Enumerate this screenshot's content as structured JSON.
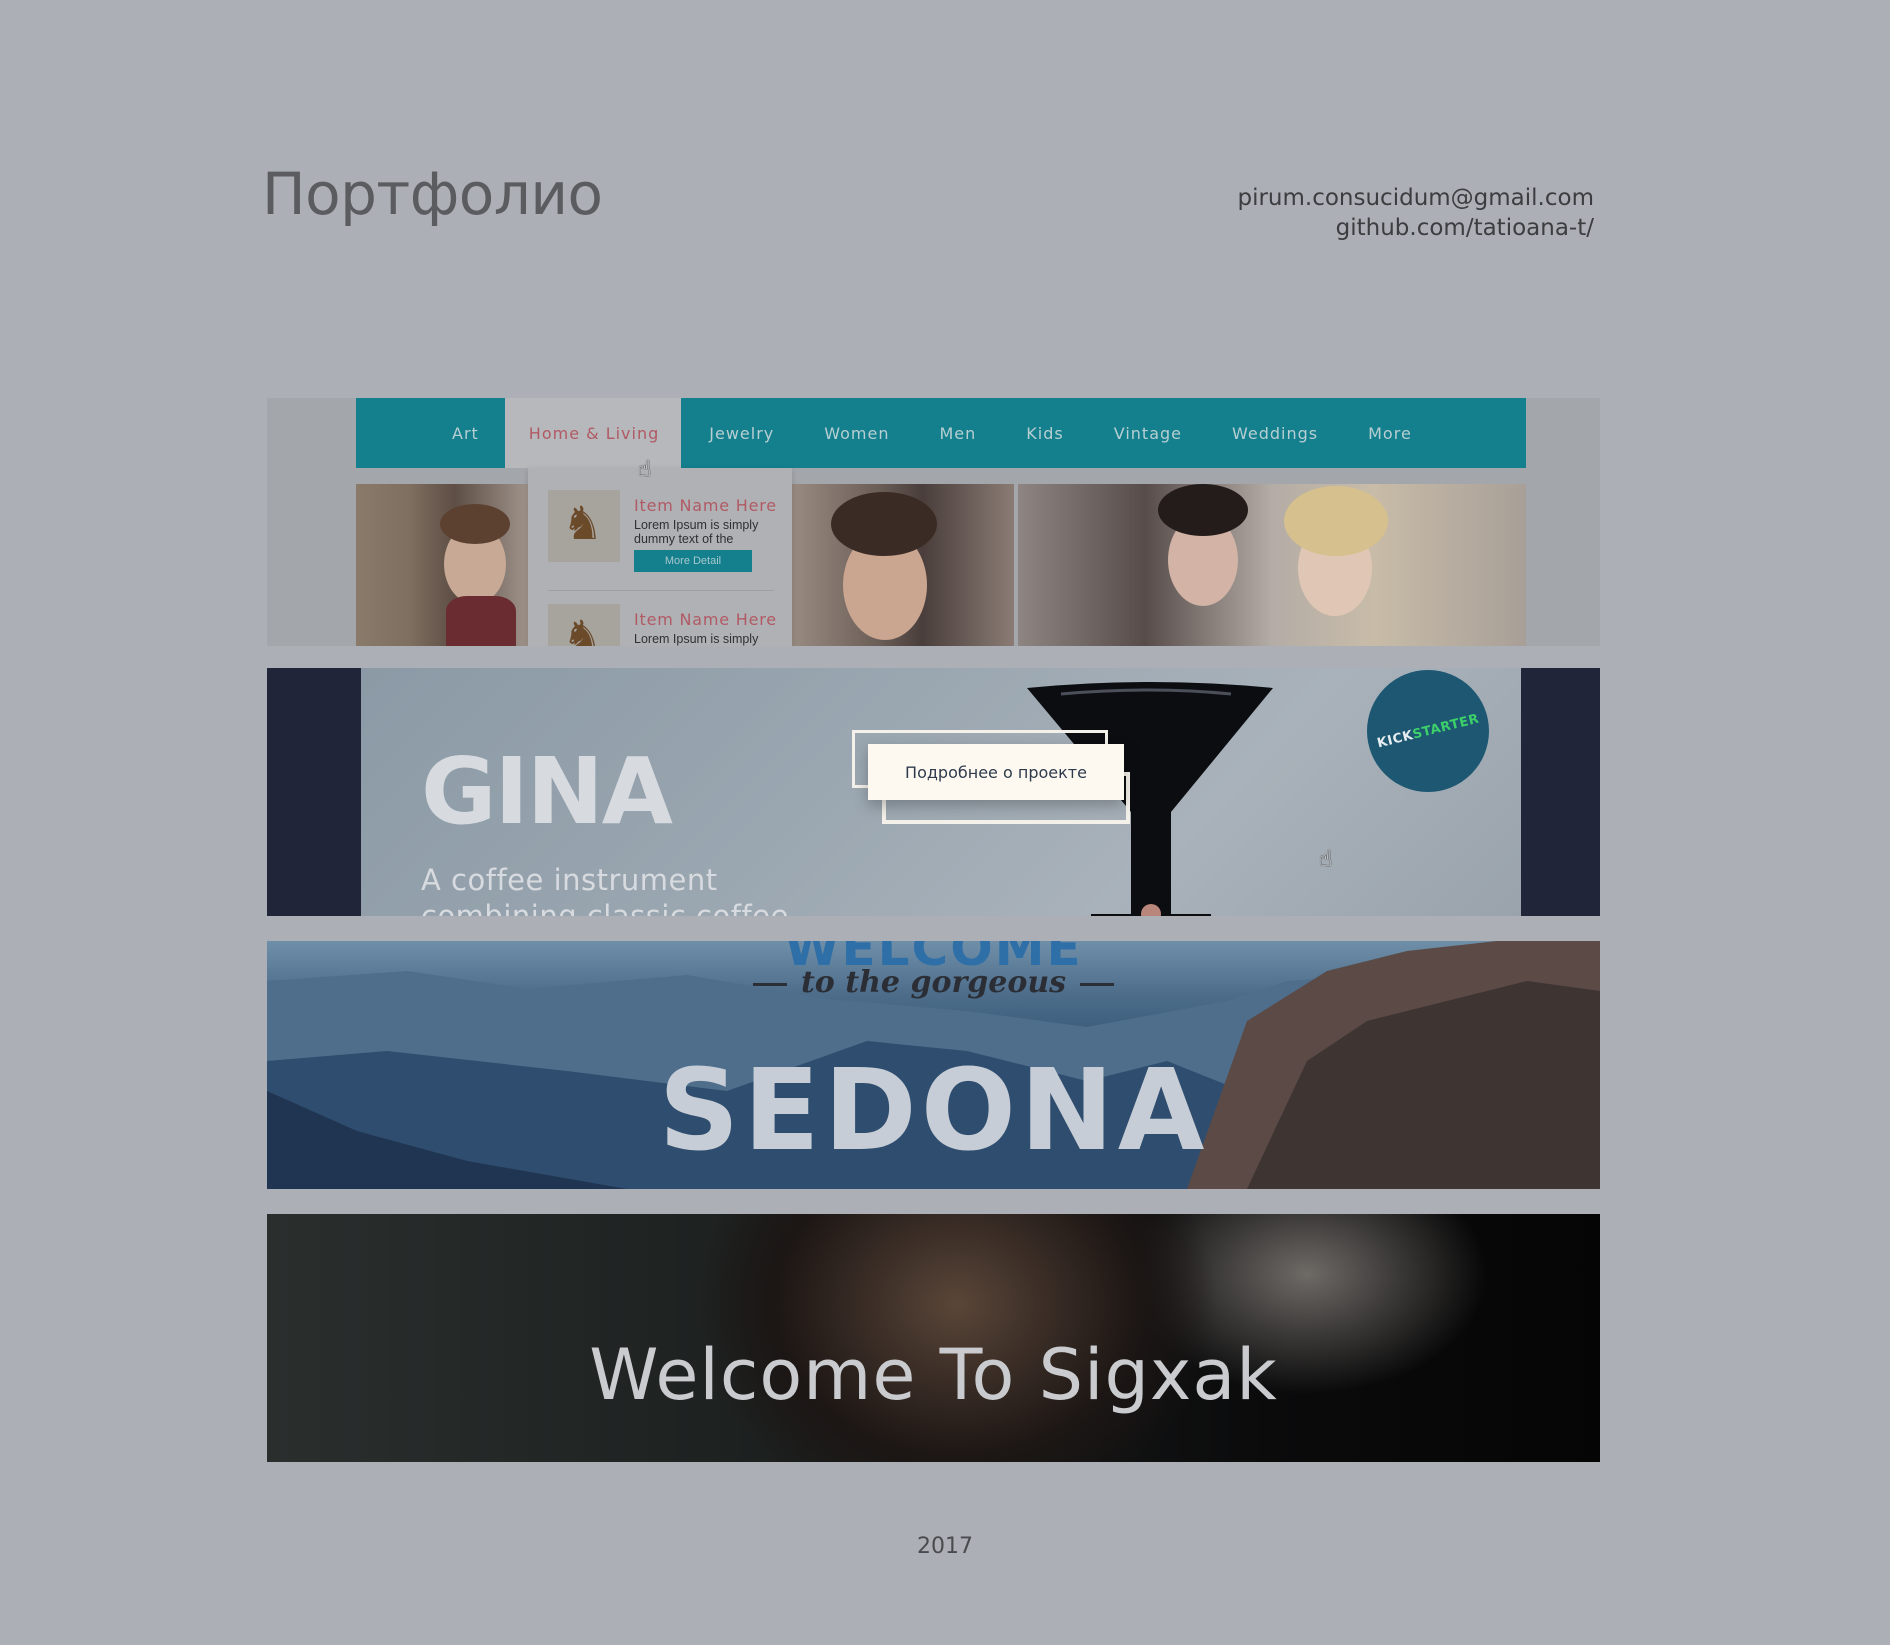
{
  "header": {
    "title": "Портфолио",
    "email": "pirum.consucidum@gmail.com",
    "github": "github.com/tatioana-t/"
  },
  "shop": {
    "nav": [
      "Art",
      "Home & Living",
      "Jewelry",
      "Women",
      "Men",
      "Kids",
      "Vintage",
      "Weddings",
      "More"
    ],
    "dropdown": [
      {
        "name": "Item Name Here",
        "text": "Lorem Ipsum is simply dummy text of the",
        "button": "More Detail"
      },
      {
        "name": "Item Name Here",
        "text": "Lorem Ipsum is simply",
        "button": ""
      }
    ]
  },
  "gina": {
    "logo": "GINA",
    "tagline": "A coffee instrument combining classic coffee",
    "cta": "Подробнее о проекте",
    "badge_a": "KICK",
    "badge_b": "STARTER"
  },
  "sedona": {
    "welcome": "WELCOME",
    "subtitle": "to the gorgeous",
    "name": "SEDONA"
  },
  "sigxak": {
    "headline": "Welcome To Sigxak"
  },
  "footer": {
    "year": "2017"
  },
  "colors": {
    "background": "#acafb5",
    "nav_teal": "#147f8d",
    "accent_red": "#b15a64",
    "gina_dark": "#20253a"
  }
}
